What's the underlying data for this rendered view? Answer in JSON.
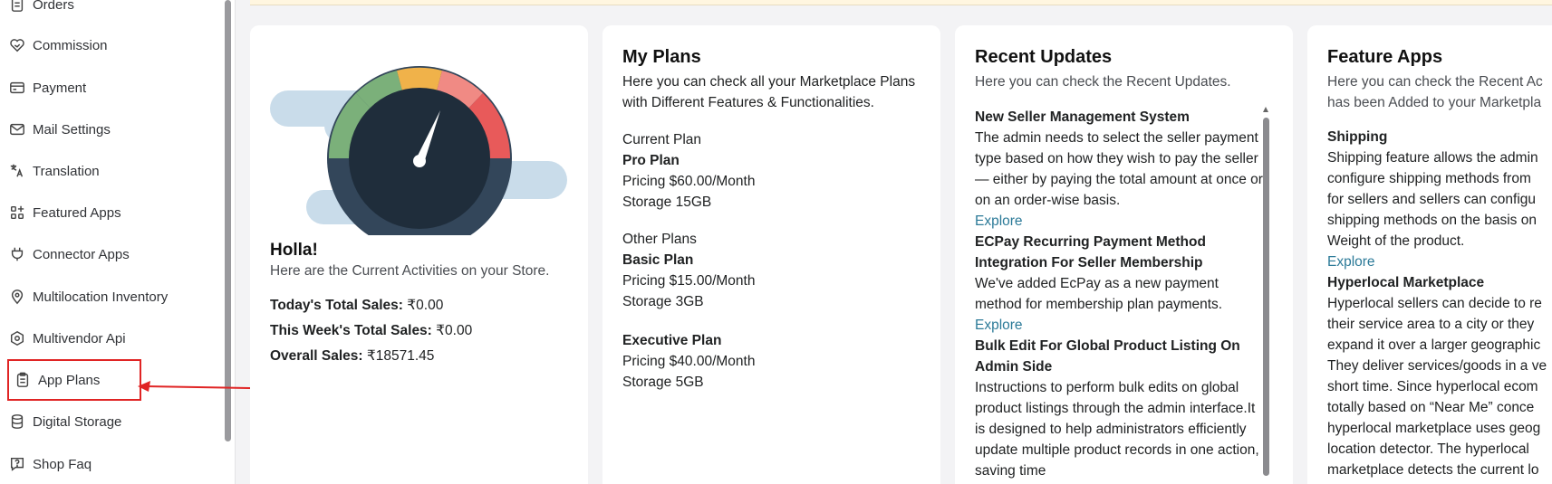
{
  "sidebar": {
    "items": [
      {
        "label": "Orders",
        "icon": "orders-icon"
      },
      {
        "label": "Commission",
        "icon": "commission-icon"
      },
      {
        "label": "Payment",
        "icon": "payment-icon"
      },
      {
        "label": "Mail Settings",
        "icon": "mail-icon"
      },
      {
        "label": "Translation",
        "icon": "translation-icon"
      },
      {
        "label": "Featured Apps",
        "icon": "featured-apps-icon"
      },
      {
        "label": "Connector Apps",
        "icon": "plug-icon"
      },
      {
        "label": "Multilocation Inventory",
        "icon": "location-pin-icon"
      },
      {
        "label": "Multivendor Api",
        "icon": "api-icon"
      },
      {
        "label": "App Plans",
        "icon": "clipboard-icon"
      },
      {
        "label": "Digital Storage",
        "icon": "database-icon"
      },
      {
        "label": "Shop Faq",
        "icon": "faq-icon"
      }
    ]
  },
  "activity": {
    "title": "Holla!",
    "subtitle": "Here are the Current Activities on your Store.",
    "today_label": "Today's Total Sales:",
    "today_value": "₹0.00",
    "week_label": "This Week's Total Sales:",
    "week_value": "₹0.00",
    "overall_label": "Overall Sales:",
    "overall_value": "₹18571.45",
    "gauge_colors": [
      "#7bb07a",
      "#f0b24a",
      "#f08a84",
      "#e85a5a",
      "#33465a",
      "#1f2d3b"
    ]
  },
  "plans": {
    "title": "My Plans",
    "subtitle": "Here you can check all your Marketplace Plans with Different Features & Functionalities.",
    "current_label": "Current Plan",
    "current_name": "Pro Plan",
    "current_price": "Pricing $60.00/Month",
    "current_storage": "Storage 15GB",
    "other_label": "Other Plans",
    "others": [
      {
        "name": "Basic Plan",
        "price": "Pricing $15.00/Month",
        "storage": "Storage 3GB"
      },
      {
        "name": "Executive Plan",
        "price": "Pricing $40.00/Month",
        "storage": "Storage 5GB"
      }
    ]
  },
  "updates": {
    "title": "Recent Updates",
    "subtitle": "Here you can check the Recent Updates.",
    "items": [
      {
        "title": "New Seller Management System",
        "body": "The admin needs to select the seller payment type based on how they wish to pay the seller — either by paying the total amount at once or on an order-wise basis.",
        "link": "Explore"
      },
      {
        "title": "ECPay Recurring Payment Method Integration For Seller Membership",
        "body": "We've added EcPay as a new payment method for membership plan payments.",
        "link": "Explore"
      },
      {
        "title": "Bulk Edit For Global Product Listing On Admin Side",
        "body": "Instructions to perform bulk edits on global product listings through the admin interface.It is designed to help administrators efficiently update multiple product records in one action, saving time",
        "link": ""
      }
    ]
  },
  "features": {
    "title": "Feature Apps",
    "subtitle_line1": "Here you can check the Recent Ac",
    "subtitle_line2": "has been Added to your Marketpla",
    "items": [
      {
        "title": "Shipping",
        "lines": [
          "Shipping feature allows the admin",
          "configure shipping methods from",
          "for sellers and sellers can configu",
          "shipping methods on the basis on",
          "Weight of the product."
        ],
        "link": "Explore"
      },
      {
        "title": "Hyperlocal Marketplace",
        "lines": [
          "Hyperlocal sellers can decide to re",
          "their service area to a city or they",
          "expand it over a larger geographic",
          "They deliver services/goods in a ve",
          "short time. Since hyperlocal ecom",
          "totally based on “Near Me” conce",
          "hyperlocal marketplace uses geog",
          "location detector. The hyperlocal",
          "marketplace detects the current lo"
        ],
        "link": ""
      }
    ]
  }
}
